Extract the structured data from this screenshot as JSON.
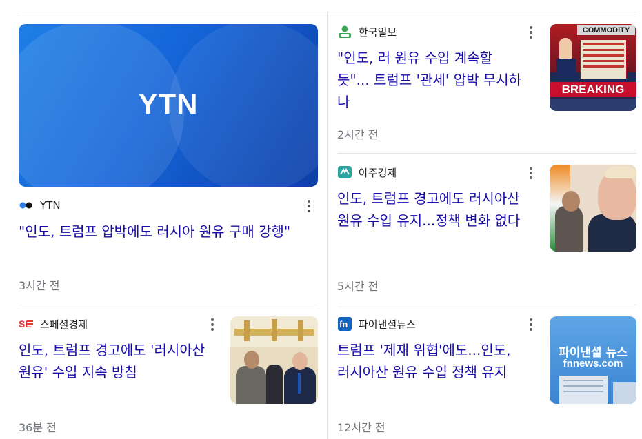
{
  "cards": [
    {
      "source": "YTN",
      "logo_icon": "ytn-dots-icon",
      "thumbnail_text": "YTN",
      "title": "\"인도, 트럼프 압박에도 러시아 원유 구매 강행\"",
      "time": "3시간 전"
    },
    {
      "source": "한국일보",
      "logo_icon": "person-green-icon",
      "title_lines": [
        "\"인도, 러 원유 수입 계속할",
        "듯\"... 트럼프 '관세' 압박 무시하",
        "나"
      ],
      "time": "2시간 전",
      "thumbnail_text_top": "COMMODITY",
      "thumbnail_text_bottom": "BREAKING"
    },
    {
      "source": "아주경제",
      "logo_icon": "ajou-logo-icon",
      "title_lines": [
        "인도, 트럼프 경고에도 러시아산",
        "원유 수입 유지...정책 변화 없다"
      ],
      "time": "5시간 전"
    },
    {
      "source": "스페셜경제",
      "logo_icon": "se-logo-icon",
      "title_lines": [
        "인도, 트럼프 경고에도 '러시아산",
        "원유' 수입 지속 방침"
      ],
      "time": "36분 전"
    },
    {
      "source": "파이낸셜뉴스",
      "logo_icon": "fn-logo-icon",
      "title_lines": [
        "트럼프 '제재 위협'에도...인도,",
        "러시아산 원유 수입 정책 유지"
      ],
      "time": "12시간 전",
      "thumbnail_text_top": "파이낸셜 뉴스",
      "thumbnail_text_bottom": "fnnews.com"
    }
  ],
  "colors": {
    "title_link": "#1a0dab",
    "meta": "#70757a",
    "divider": "#e3e3e3"
  }
}
